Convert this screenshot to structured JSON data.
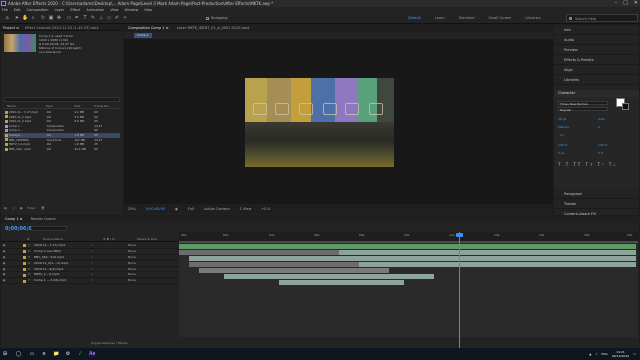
{
  "titlebar": {
    "title": "Adobe After Effects 2020 - C:\\Users\\adams\\Desktop\\... Adam Page\\Level 3 Mark Adam Page\\Post-Production\\After Effects\\MKTK.aep *"
  },
  "window_controls": [
    "–",
    "□",
    "✕"
  ],
  "menu": [
    "File",
    "Edit",
    "Composition",
    "Layer",
    "Effect",
    "Animation",
    "View",
    "Window",
    "Help"
  ],
  "toolbar": {
    "snapping": "Snapping"
  },
  "workspaces": {
    "active": "Default",
    "items": [
      "Learn",
      "Standard",
      "Small Screen",
      "Libraries"
    ]
  },
  "help_search": {
    "placeholder": "Search Help"
  },
  "project_panel": {
    "tabs": [
      "Project ≡",
      "Effect Controls 2020-11-15 (1-45-33).mp4"
    ],
    "info": [
      "Comp 1 ▾, used 1 time",
      "1920 x 1080 (1.00)",
      "Δ 0;00;28;09, 29.97 fps",
      "Millions of Colours (Straight)",
      "non-interlaced"
    ],
    "columns": {
      "name": "Name",
      "type": "Type",
      "size": "Size",
      "frame_rate": "Frame Ra..."
    },
    "items": [
      {
        "name": "2020-11...7-17).mp4",
        "type": "AVI",
        "size": "4.1 MB",
        "fr": "60"
      },
      {
        "name": "2020-11_2.mp4",
        "type": "AVI",
        "size": "5.6 MB",
        "fr": "60"
      },
      {
        "name": "2020-11_2.mp4",
        "type": "AVI",
        "size": "9.0 MB",
        "fr": "60"
      },
      {
        "name": "Comp 1",
        "type": "Composition",
        "size": "",
        "fr": "29.97"
      },
      {
        "name": "Comp 1...",
        "type": "Composition",
        "size": "",
        "fr": "60"
      },
      {
        "name": "footage...",
        "type": "AVI",
        "size": "1.8 MB",
        "fr": "60"
      },
      {
        "name": "BNC_ISOEM6V",
        "type": "QuickTime",
        "size": "107 MB",
        "fr": "29.97"
      },
      {
        "name": "MKTV_1.0.mp4",
        "type": "AVI",
        "size": "1.6 MB",
        "fr": "25"
      },
      {
        "name": "BNC_262...mp4",
        "type": "AVI",
        "size": "42.1 MB",
        "fr": "60"
      }
    ],
    "footer": [
      "8 bpc"
    ]
  },
  "composition_panel": {
    "tabs": [
      "Composition Comp 1 ≡",
      "Layer MKTK_IDENT_01_A_0001-0125.mp4"
    ],
    "subtab": "Comp 1",
    "footer": {
      "zoom": "25%",
      "timecode": "0;00;00;00",
      "quality": "Full",
      "camera": "Active Camera",
      "views": "1 View",
      "exposure": "+0.0"
    }
  },
  "right_panel": {
    "items": [
      "Info",
      "Audio",
      "Preview",
      "Effects & Presets",
      "Align",
      "Libraries"
    ],
    "character": {
      "title": "Character",
      "font": "Times New Roman",
      "style": "Regular",
      "size": "36 px",
      "leading": "Auto",
      "kerning": "Metrics",
      "tracking": "0",
      "stroke": "- px",
      "vscale": "100 %",
      "hscale": "100 %",
      "baseline": "0 px",
      "tsume": "0 %"
    },
    "below": [
      "Paragraph",
      "Tracker",
      "Content-Aware Fill"
    ]
  },
  "timeline": {
    "tabs": [
      "Comp 1 ≡",
      "Render Queue"
    ],
    "timecode": "0;00;06;03",
    "columns": {
      "name": "Source Name",
      "switches": "⚙ ✱ \\ fx",
      "parent": "Parent & Link"
    },
    "layers": [
      {
        "num": "1",
        "name": "2020-11...7-17).mp4",
        "parent": "None"
      },
      {
        "num": "2",
        "name": "Comp 1.mov.MOV",
        "parent": "None"
      },
      {
        "num": "3",
        "name": "BNC_262...512.mp4",
        "parent": "None"
      },
      {
        "num": "4",
        "name": "2020-11_2(1-...2).mp4",
        "parent": "None"
      },
      {
        "num": "5",
        "name": "2020-11...2(2).mp4",
        "parent": "None"
      },
      {
        "num": "6",
        "name": "MKTV_1....0.mp4",
        "parent": "None"
      },
      {
        "num": "7",
        "name": "Comp 1 ....3-24).mp4",
        "parent": "None"
      }
    ],
    "ruler_ticks": [
      "00s",
      "02s",
      "04s",
      "06s",
      "08s",
      "10s",
      "12s",
      "14s",
      "16s",
      "18s",
      "20s"
    ],
    "footer": "Toggle Switches / Modes"
  },
  "taskbar": {
    "apps": [
      "⊞",
      "◯",
      "▭",
      "e",
      "📁",
      "⚙",
      "♪",
      "Ae"
    ],
    "time": "14:21",
    "date": "06/12/2020",
    "lang": "ENG"
  }
}
